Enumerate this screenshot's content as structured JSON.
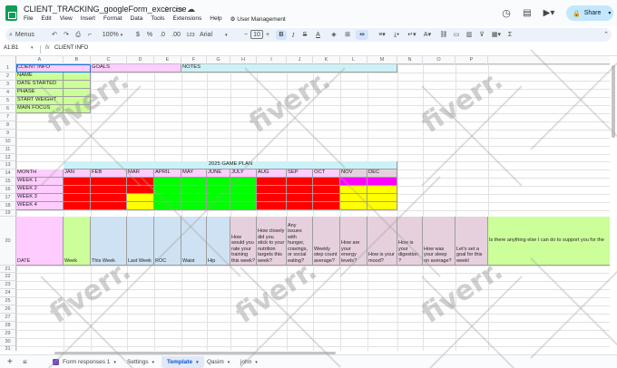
{
  "app": {
    "doc_title": "CLIENT_TRACKING_googleForm_excercise",
    "menu": [
      "File",
      "Edit",
      "View",
      "Insert",
      "Format",
      "Data",
      "Tools",
      "Extensions",
      "Help"
    ],
    "user_management": "User Management",
    "share_label": "Share"
  },
  "toolbar": {
    "menus": "Menus",
    "zoom": "100%",
    "currency": "$",
    "percent": "%",
    "dec_less": ".0",
    "dec_more": ".00",
    "number_format": "123",
    "font": "Arial",
    "font_size": "10",
    "minus": "−",
    "plus": "+",
    "bold": "B",
    "italic": "I",
    "strike": "S",
    "text_color": "A",
    "function": "Σ"
  },
  "formula_bar": {
    "cell_ref": "A1:B1",
    "fx": "fx",
    "value": "CLIENT INFO"
  },
  "columns": [
    "A",
    "B",
    "C",
    "D",
    "E",
    "F",
    "G",
    "H",
    "I",
    "J",
    "K",
    "L",
    "M",
    "N",
    "O",
    "P"
  ],
  "rows": [
    "1",
    "2",
    "3",
    "4",
    "5",
    "6",
    "7",
    "8",
    "9",
    "10",
    "11",
    "12",
    "13",
    "14",
    "15",
    "16",
    "17",
    "18",
    "19",
    "20",
    "21",
    "22",
    "23",
    "24",
    "25",
    "26",
    "27",
    "28",
    "29",
    "30",
    "31"
  ],
  "sheet": {
    "client_info": "CLIENT INFO",
    "goals": "GOALS",
    "notes": "NOTES",
    "info_labels": [
      "NAME",
      "DATE STARTED",
      "PHASE",
      "START WEIGHT",
      "MAIN FOCUS"
    ],
    "game_plan_title": "2025 GAME PLAN",
    "month_label": "MONTH",
    "months": [
      "JAN",
      "FEB",
      "MAR",
      "APRIL",
      "MAY",
      "JUNE",
      "JULY",
      "AUG",
      "SEP",
      "OCT",
      "NOV",
      "DEC"
    ],
    "weeks": [
      "WEEK 1",
      "WEEK 2",
      "WEEK 3",
      "WEEK 4"
    ],
    "week_colors": [
      [
        "#ff0000",
        "#ff0000",
        "#ff0000",
        "#00ff00",
        "#00ff00",
        "#00ff00",
        "#00ff00",
        "#ff0000",
        "#ff0000",
        "#ff0000",
        "#ff00ff",
        "#ff00ff"
      ],
      [
        "#ff0000",
        "#ff0000",
        "#ff0000",
        "#00ff00",
        "#00ff00",
        "#00ff00",
        "#00ff00",
        "#ff0000",
        "#ff0000",
        "#ff0000",
        "#ffff00",
        "#ffff00"
      ],
      [
        "#ff0000",
        "#ff0000",
        "#ffff00",
        "#00ff00",
        "#00ff00",
        "#00ff00",
        "#00ff00",
        "#ff0000",
        "#ff0000",
        "#ff0000",
        "#ffff00",
        "#ffff00"
      ],
      [
        "#ff0000",
        "#ff0000",
        "#ffff00",
        "#00ff00",
        "#00ff00",
        "#00ff00",
        "#00ff00",
        "#ff0000",
        "#ff0000",
        "#ff0000",
        "#ffff00",
        "#ffff00"
      ]
    ],
    "form_headers": [
      "DATE",
      "Week",
      "This Week",
      "Last Week",
      "ROC",
      "Waist",
      "Hip",
      "How would you rate your training this week?",
      "How closely did you stick to your nutrition targets this week?",
      "Any issues with hunger, cravings, or social eating?",
      "Weekly step count average?",
      "How are your energy levels?",
      "How is your mood?",
      "How is your digestion ?",
      "How was your sleep on average?",
      "Let's set a goal for this week!",
      "Is there anything else I can do to support you for the"
    ]
  },
  "sheet_tabs": [
    "Form responses 1",
    "Settings",
    "Template",
    "Qasim",
    "john"
  ],
  "active_tab": "Template",
  "watermark": "fiverr.",
  "colors": {
    "pink": "#ffccff",
    "light_green": "#ccff99",
    "cyan": "#ccf2f7",
    "light_blue": "#cfe2f3",
    "lavender": "#e6d0de"
  }
}
